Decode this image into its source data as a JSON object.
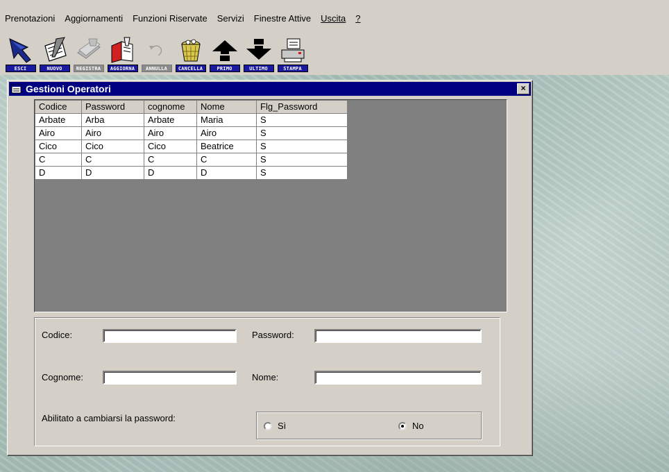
{
  "menubar": {
    "items": [
      "Prenotazioni",
      "Aggiornamenti",
      "Funzioni Riservate",
      "Servizi",
      "Finestre Attive",
      "Uscita",
      "?"
    ]
  },
  "toolbar": {
    "buttons": [
      {
        "label": "ESCI",
        "icon": "exit-arrow-icon",
        "enabled": true
      },
      {
        "label": "NUOVO",
        "icon": "new-pen-paper-icon",
        "enabled": true
      },
      {
        "label": "REGISTRA",
        "icon": "save-papers-icon",
        "enabled": false
      },
      {
        "label": "AGGIORNA",
        "icon": "update-book-icon",
        "enabled": true
      },
      {
        "label": "ANNULLA",
        "icon": "undo-arrow-icon",
        "enabled": false
      },
      {
        "label": "CANCELLA",
        "icon": "trash-basket-icon",
        "enabled": true
      },
      {
        "label": "PRIMO",
        "icon": "arrow-up-icon",
        "enabled": true
      },
      {
        "label": "ULTIMO",
        "icon": "arrow-down-icon",
        "enabled": true
      },
      {
        "label": "STAMPA",
        "icon": "printer-icon",
        "enabled": true
      }
    ]
  },
  "window": {
    "title": "Gestioni Operatori",
    "close_label": "×"
  },
  "grid": {
    "columns": [
      "Codice",
      "Password",
      "cognome",
      "Nome",
      "Flg_Password"
    ],
    "rows": [
      [
        "Arbate",
        "Arba",
        "Arbate",
        "Maria",
        "S"
      ],
      [
        "Airo",
        "Airo",
        "Airo",
        "Airo",
        "S"
      ],
      [
        "Cico",
        "Cico",
        "Cico",
        "Beatrice",
        "S"
      ],
      [
        "C",
        "C",
        "C",
        "C",
        "S"
      ],
      [
        "D",
        "D",
        "D",
        "D",
        "S"
      ]
    ]
  },
  "form": {
    "codice_label": "Codice:",
    "codice_value": "",
    "password_label": "Password:",
    "password_value": "",
    "cognome_label": "Cognome:",
    "cognome_value": "",
    "nome_label": "Nome:",
    "nome_value": "",
    "abilitato_label": "Abilitato a cambiarsi la password:",
    "radio_si": "Sì",
    "radio_no": "No",
    "selected": "No"
  },
  "colors": {
    "titlebar": "#000080",
    "face": "#d4d0c8",
    "grid_background": "#808080"
  }
}
